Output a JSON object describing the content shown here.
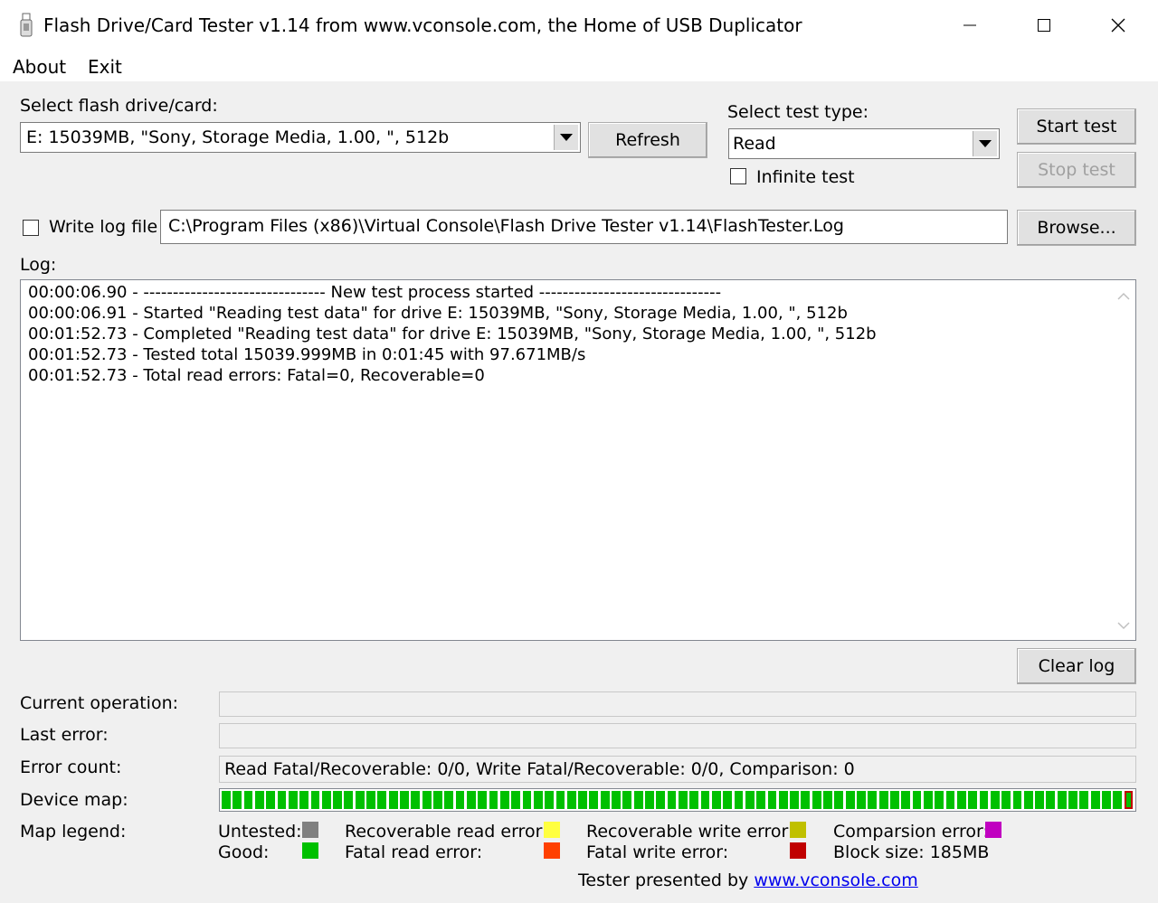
{
  "window": {
    "title": "Flash Drive/Card Tester v1.14 from www.vconsole.com, the Home of USB Duplicator",
    "minimize_icon": "minimize-icon",
    "maximize_icon": "maximize-icon",
    "close_icon": "close-icon"
  },
  "menu": {
    "about": "About",
    "exit": "Exit"
  },
  "drive": {
    "label": "Select flash drive/card:",
    "value": "E: 15039MB, \"Sony, Storage Media, 1.00, \", 512b",
    "refresh": "Refresh"
  },
  "test_type": {
    "label": "Select test type:",
    "value": "Read",
    "infinite": "Infinite test",
    "infinite_checked": false
  },
  "buttons": {
    "start": "Start test",
    "stop": "Stop test",
    "browse": "Browse...",
    "clear_log": "Clear log"
  },
  "logfile": {
    "label": "Write log file",
    "checked": false,
    "path": "C:\\Program Files (x86)\\Virtual Console\\Flash Drive Tester v1.14\\FlashTester.Log"
  },
  "log": {
    "label": "Log:",
    "lines": [
      "00:00:06.90 - ------------------------------- New test process started -------------------------------",
      "00:00:06.91 - Started \"Reading test data\" for drive E: 15039MB, \"Sony, Storage Media, 1.00, \", 512b",
      "00:01:52.73 - Completed \"Reading test data\" for drive E: 15039MB, \"Sony, Storage Media, 1.00, \", 512b",
      "00:01:52.73 - Tested total 15039.999MB in 0:01:45 with 97.671MB/s",
      "00:01:52.73 - Total read errors: Fatal=0, Recoverable=0"
    ]
  },
  "status": {
    "current_op_label": "Current operation:",
    "current_op": "",
    "last_error_label": "Last error:",
    "last_error": "",
    "error_count_label": "Error count:",
    "error_count": "Read Fatal/Recoverable: 0/0, Write Fatal/Recoverable: 0/0, Comparison: 0",
    "device_map_label": "Device map:",
    "map_legend_label": "Map legend:"
  },
  "device_map": {
    "blocks_total": 82,
    "good_blocks": 81,
    "current_block_color": "#c00000"
  },
  "legend": {
    "untested": "Untested:",
    "good": "Good:",
    "rec_read": "Recoverable read error:",
    "fatal_read": "Fatal read error:",
    "rec_write": "Recoverable write error:",
    "fatal_write": "Fatal write error:",
    "comparison": "Comparsion error:",
    "block_size": "Block size: 185MB",
    "colors": {
      "untested": "#808080",
      "good": "#00c000",
      "rec_read": "#ffff40",
      "fatal_read": "#ff4000",
      "rec_write": "#c0c000",
      "fatal_write": "#c00000",
      "comparison": "#c000c0"
    }
  },
  "footer": {
    "text": "Tester presented by",
    "link": "www.vconsole.com"
  }
}
